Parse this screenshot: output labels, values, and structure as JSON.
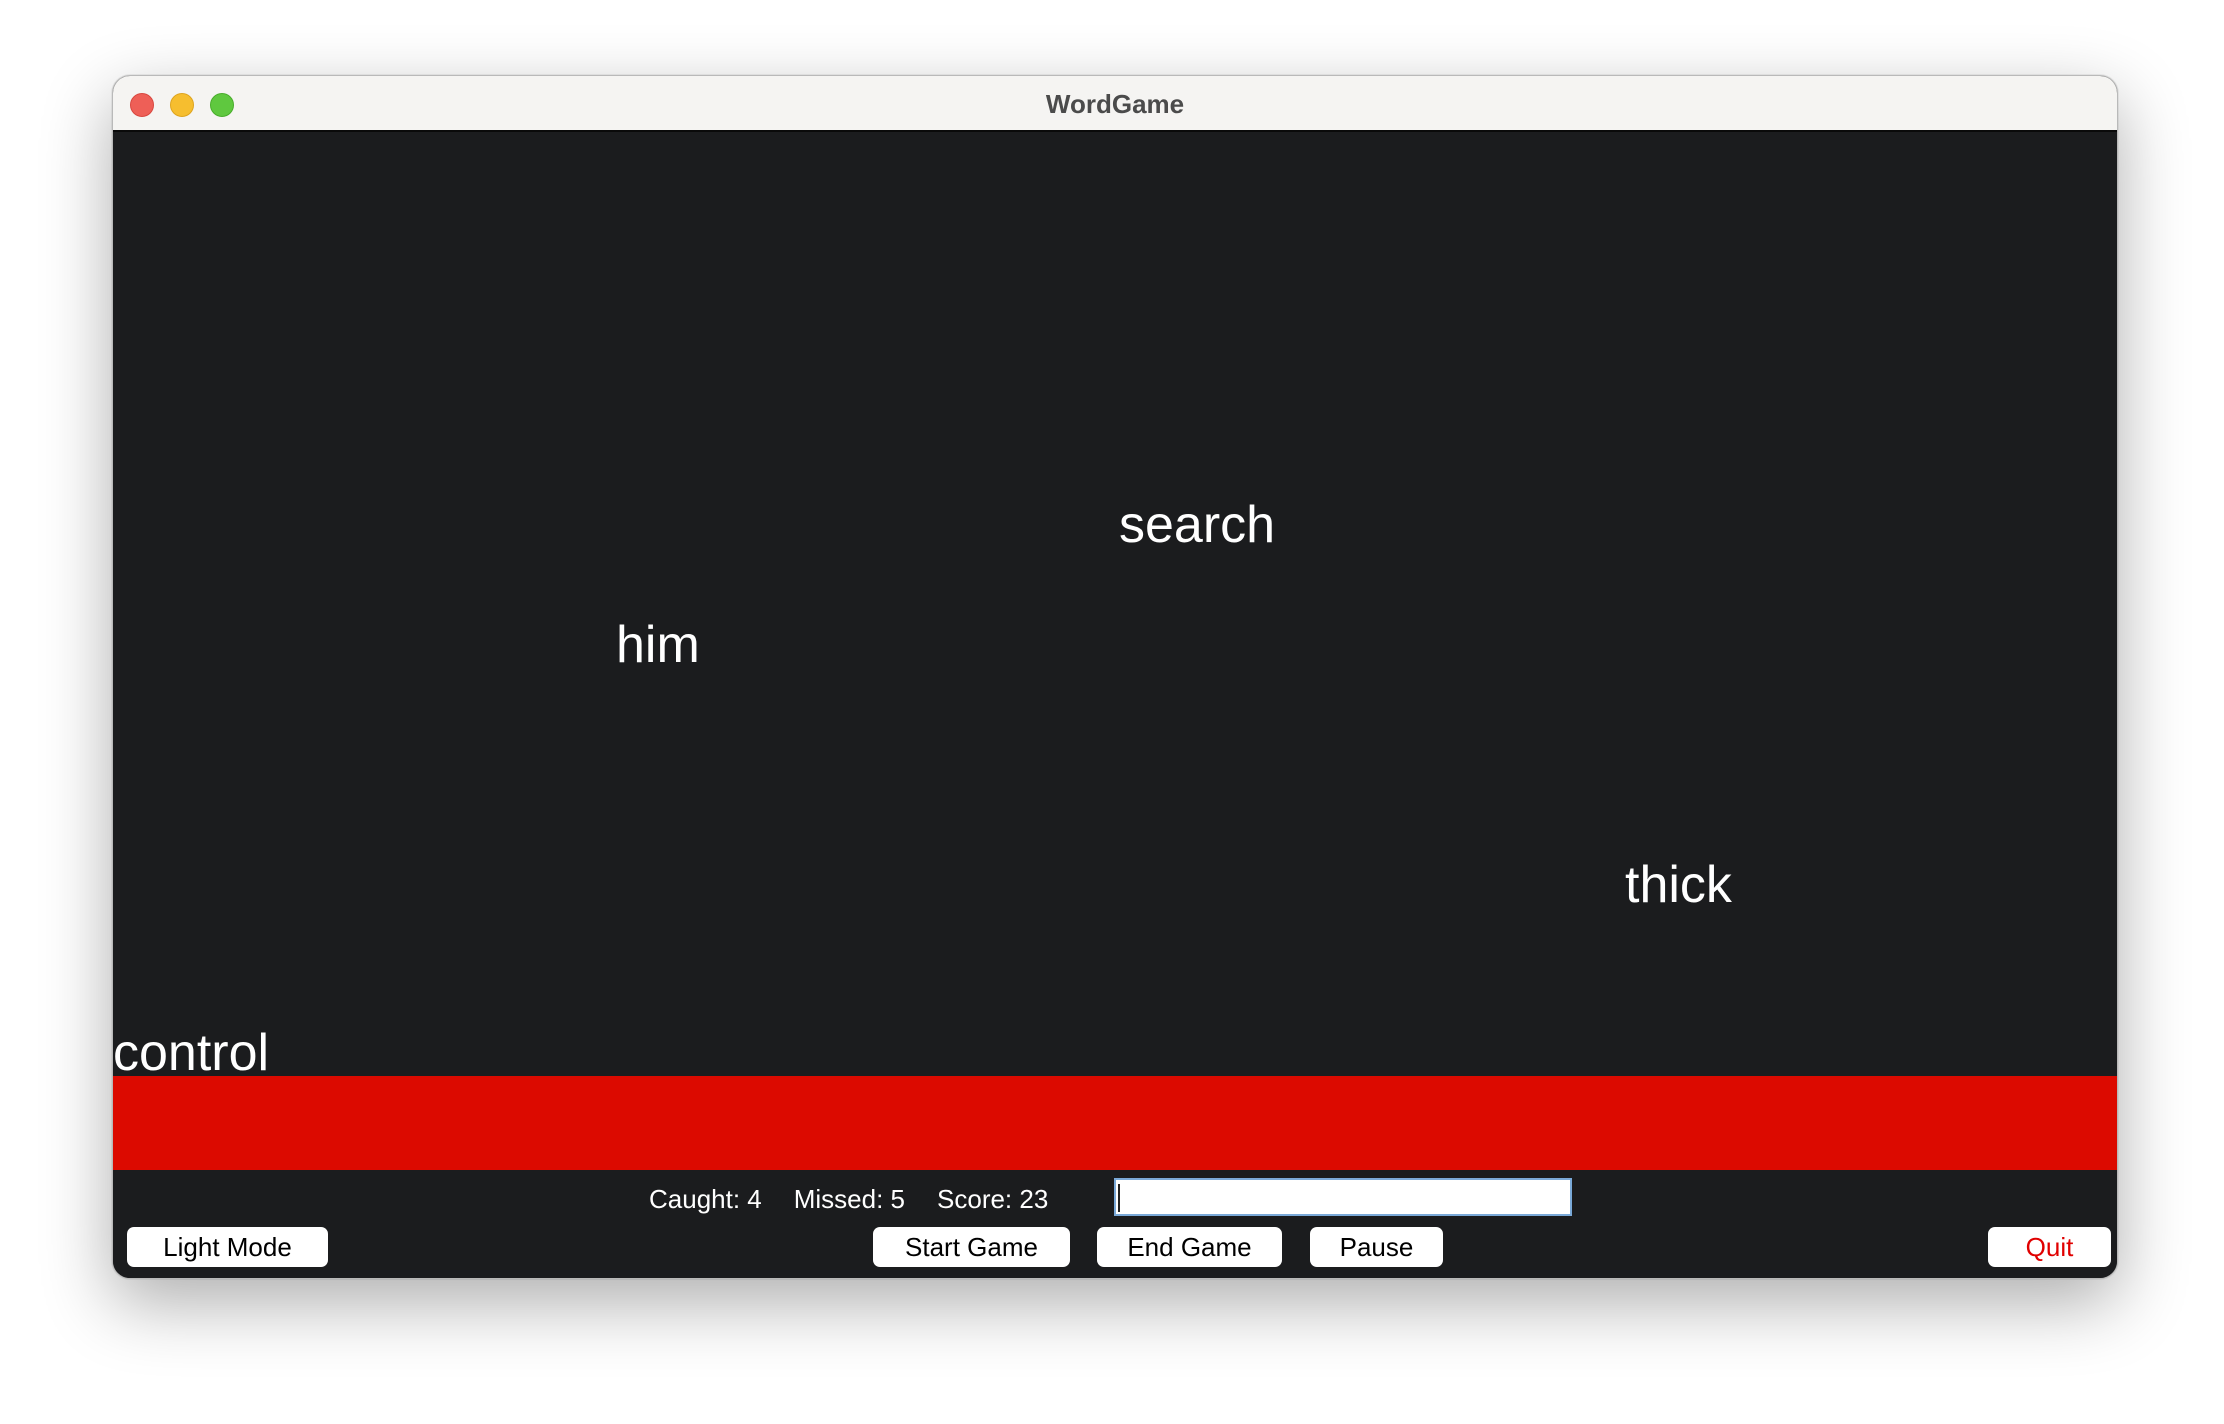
{
  "window": {
    "title": "WordGame"
  },
  "theme": {
    "background": "#1b1c1e",
    "word_color": "#ffffff",
    "danger_zone_color": "#dc0a00",
    "quit_text_color": "#e00000"
  },
  "words": [
    {
      "text": "search"
    },
    {
      "text": "him"
    },
    {
      "text": "thick"
    },
    {
      "text": "control"
    }
  ],
  "stats": {
    "caught": "Caught: 4",
    "missed": "Missed: 5",
    "score": "Score: 23"
  },
  "input": {
    "value": ""
  },
  "buttons": {
    "light_mode": "Light Mode",
    "start_game": "Start Game",
    "end_game": "End Game",
    "pause": "Pause",
    "quit": "Quit"
  }
}
